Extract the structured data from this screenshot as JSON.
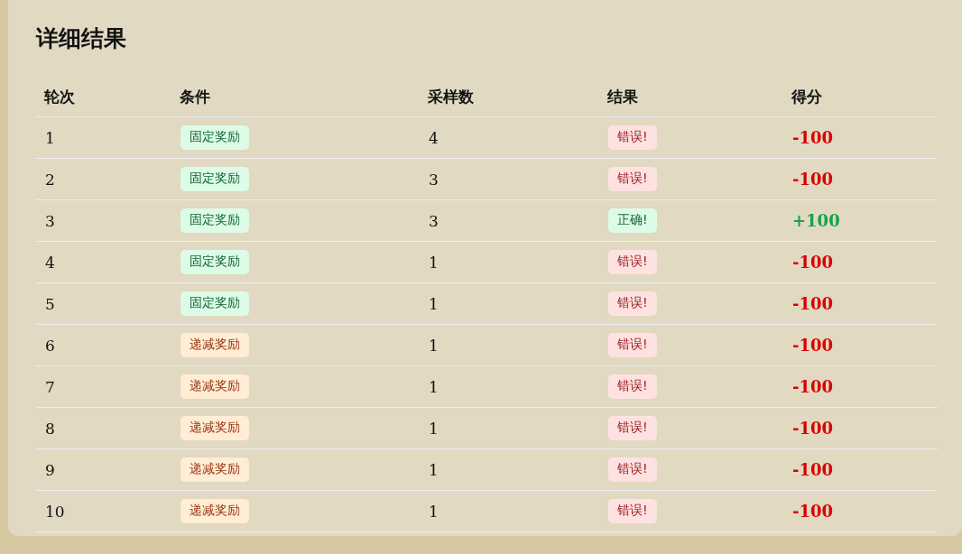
{
  "title": "详细结果",
  "columns": [
    "轮次",
    "条件",
    "采样数",
    "结果",
    "得分"
  ],
  "rows": [
    {
      "round": "1",
      "condition": {
        "label": "固定奖励",
        "kind": "fixed"
      },
      "samples": "4",
      "result": {
        "label": "错误!",
        "kind": "wrong"
      },
      "score": "-100"
    },
    {
      "round": "2",
      "condition": {
        "label": "固定奖励",
        "kind": "fixed"
      },
      "samples": "3",
      "result": {
        "label": "错误!",
        "kind": "wrong"
      },
      "score": "-100"
    },
    {
      "round": "3",
      "condition": {
        "label": "固定奖励",
        "kind": "fixed"
      },
      "samples": "3",
      "result": {
        "label": "正确!",
        "kind": "correct"
      },
      "score": "+100"
    },
    {
      "round": "4",
      "condition": {
        "label": "固定奖励",
        "kind": "fixed"
      },
      "samples": "1",
      "result": {
        "label": "错误!",
        "kind": "wrong"
      },
      "score": "-100"
    },
    {
      "round": "5",
      "condition": {
        "label": "固定奖励",
        "kind": "fixed"
      },
      "samples": "1",
      "result": {
        "label": "错误!",
        "kind": "wrong"
      },
      "score": "-100"
    },
    {
      "round": "6",
      "condition": {
        "label": "递减奖励",
        "kind": "decreasing"
      },
      "samples": "1",
      "result": {
        "label": "错误!",
        "kind": "wrong"
      },
      "score": "-100"
    },
    {
      "round": "7",
      "condition": {
        "label": "递减奖励",
        "kind": "decreasing"
      },
      "samples": "1",
      "result": {
        "label": "错误!",
        "kind": "wrong"
      },
      "score": "-100"
    },
    {
      "round": "8",
      "condition": {
        "label": "递减奖励",
        "kind": "decreasing"
      },
      "samples": "1",
      "result": {
        "label": "错误!",
        "kind": "wrong"
      },
      "score": "-100"
    },
    {
      "round": "9",
      "condition": {
        "label": "递减奖励",
        "kind": "decreasing"
      },
      "samples": "1",
      "result": {
        "label": "错误!",
        "kind": "wrong"
      },
      "score": "-100"
    },
    {
      "round": "10",
      "condition": {
        "label": "递减奖励",
        "kind": "decreasing"
      },
      "samples": "1",
      "result": {
        "label": "错误!",
        "kind": "wrong"
      },
      "score": "-100"
    }
  ]
}
